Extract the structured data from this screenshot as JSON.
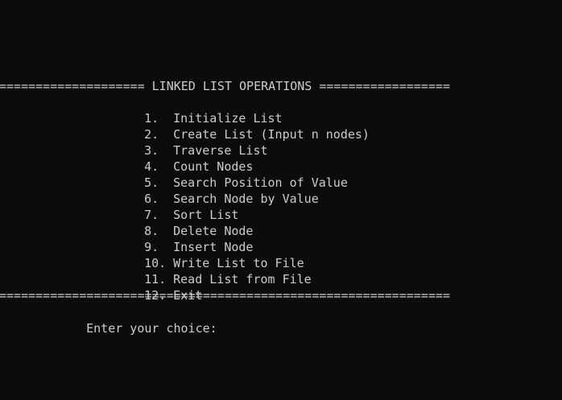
{
  "header": {
    "banner": "==================== LINKED LIST OPERATIONS =================="
  },
  "menu": {
    "items": [
      {
        "num": "1.",
        "label": "Initialize List"
      },
      {
        "num": "2.",
        "label": "Create List (Input n nodes)"
      },
      {
        "num": "3.",
        "label": "Traverse List"
      },
      {
        "num": "4.",
        "label": "Count Nodes"
      },
      {
        "num": "5.",
        "label": "Search Position of Value"
      },
      {
        "num": "6.",
        "label": "Search Node by Value"
      },
      {
        "num": "7.",
        "label": "Sort List"
      },
      {
        "num": "8.",
        "label": "Delete Node"
      },
      {
        "num": "9.",
        "label": "Insert Node"
      },
      {
        "num": "10.",
        "label": "Write List to File"
      },
      {
        "num": "11.",
        "label": "Read List from File"
      },
      {
        "num": "12.",
        "label": "Exit"
      }
    ]
  },
  "footer": {
    "banner": "=============================================================="
  },
  "prompt": {
    "text": "Enter your choice:"
  }
}
